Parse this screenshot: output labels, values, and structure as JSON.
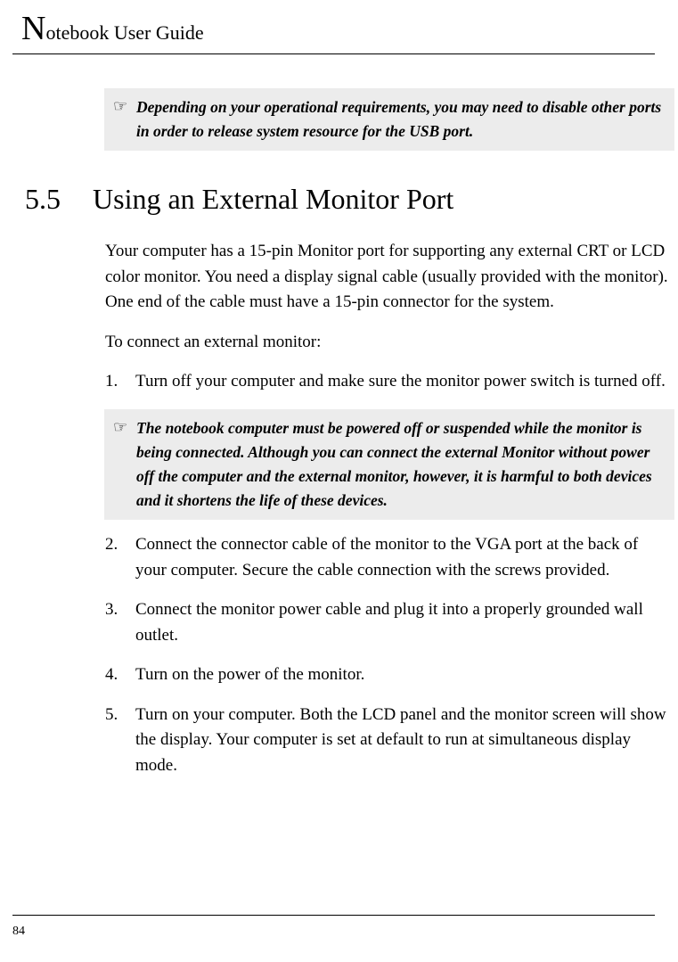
{
  "header": {
    "dropcap": "N",
    "rest": "otebook User Guide"
  },
  "note1": {
    "icon": "☞",
    "text": "Depending on your operational requirements, you may need to disable other ports in order to release system resource for the USB port."
  },
  "section": {
    "number": "5.5",
    "title": "Using an External Monitor Port"
  },
  "para1": "Your computer has a 15-pin Monitor port for supporting any external CRT or LCD color monitor. You need a display signal cable (usually provided with the monitor). One end of the cable must have a 15-pin connector for the system.",
  "para2": "To connect an external monitor:",
  "steps": [
    {
      "marker": "1.",
      "text": "Turn off your computer and make sure the monitor power switch is turned off."
    },
    {
      "marker": "2.",
      "text": "Connect the connector cable of the monitor to the VGA port at the back of your computer. Secure the cable connection with the screws provided."
    },
    {
      "marker": "3.",
      "text": "Connect the monitor power cable and plug it into a properly grounded wall outlet."
    },
    {
      "marker": "4.",
      "text": "Turn on the power of the monitor."
    },
    {
      "marker": "5.",
      "text": "Turn on your computer. Both the LCD panel and the monitor screen will show the display. Your computer is set at default to run at simultaneous display mode."
    }
  ],
  "note2": {
    "icon": "☞",
    "text": "The notebook computer must be powered off or suspended while the monitor is being connected. Although you can connect the external Monitor without power off the computer and the external monitor, however, it is harmful to both devices and it shortens the life of these devices."
  },
  "page_number": "84"
}
